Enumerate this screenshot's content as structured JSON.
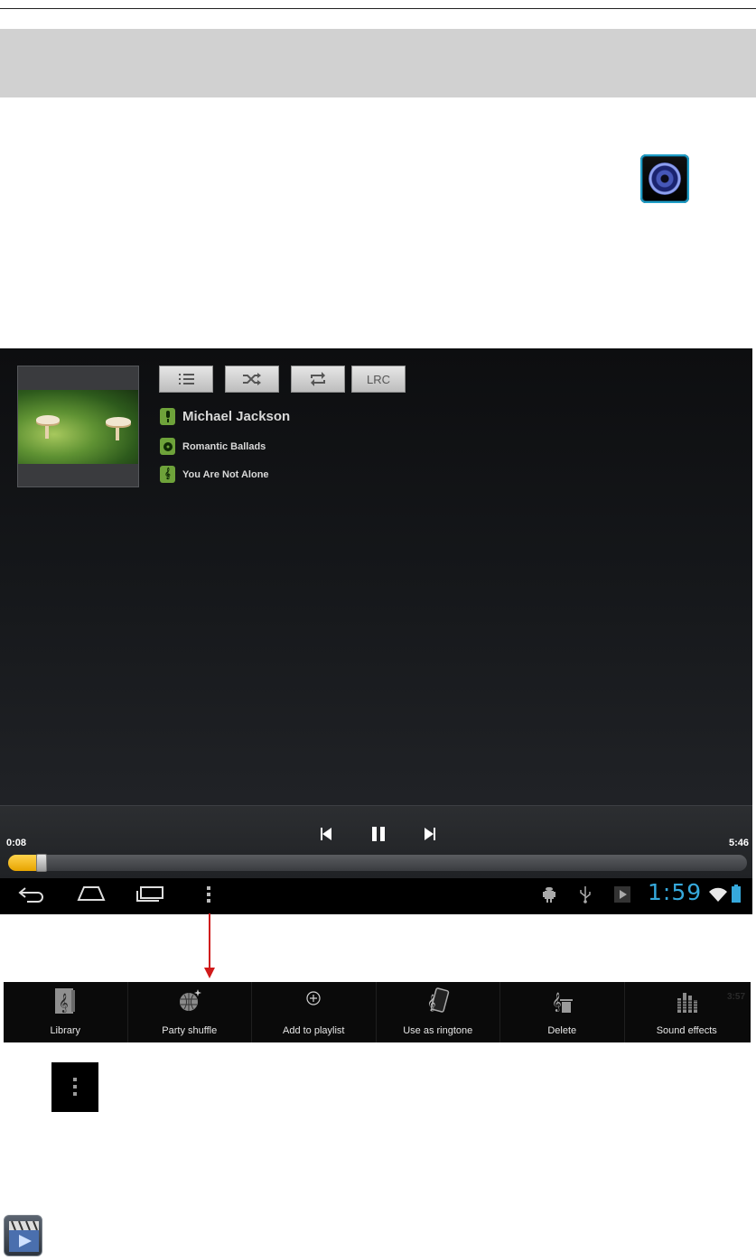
{
  "player": {
    "artist": "Michael Jackson",
    "album": "Romantic Ballads",
    "track": "You Are Not Alone",
    "lyrics_button": "LRC",
    "elapsed": "0:08",
    "duration": "5:46",
    "progress": 0.023
  },
  "status_bar": {
    "clock": "1:59"
  },
  "menu": {
    "items": [
      {
        "label": "Library",
        "icon": "library-icon"
      },
      {
        "label": "Party shuffle",
        "icon": "party-shuffle-icon"
      },
      {
        "label": "Add to playlist",
        "icon": "add-icon"
      },
      {
        "label": "Use as ringtone",
        "icon": "ringtone-icon"
      },
      {
        "label": "Delete",
        "icon": "delete-icon"
      },
      {
        "label": "Sound effects",
        "icon": "equalizer-icon"
      }
    ],
    "ghost_time": "3:57"
  },
  "colors": {
    "accent_blue": "#36a9dc",
    "progress_yellow": "#f2b600",
    "arrow_red": "#d01a1a"
  }
}
